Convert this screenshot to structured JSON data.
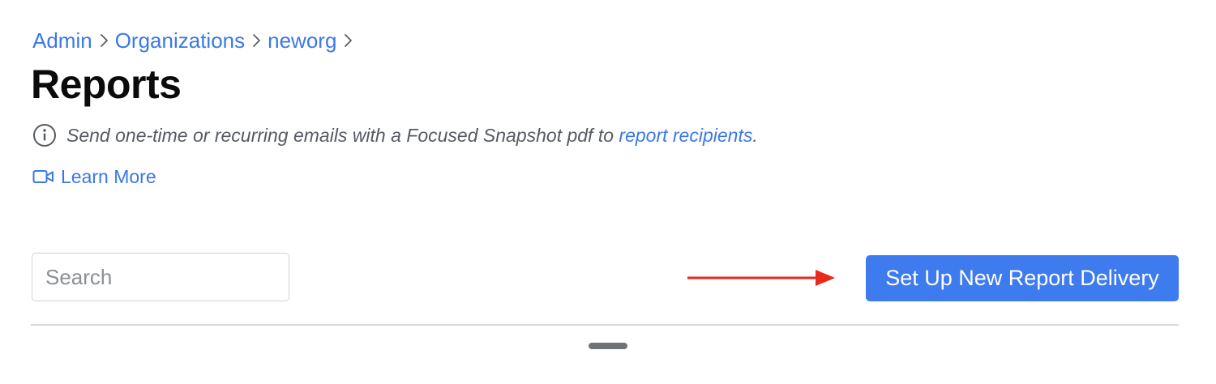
{
  "breadcrumb": {
    "items": [
      {
        "label": "Admin"
      },
      {
        "label": "Organizations"
      },
      {
        "label": "neworg"
      }
    ]
  },
  "page": {
    "title": "Reports"
  },
  "info": {
    "text": "Send one-time or recurring emails with a Focused Snapshot pdf to ",
    "link_text": "report recipients",
    "suffix": "."
  },
  "learn_more": {
    "label": "Learn More",
    "icon": "video-camera-icon"
  },
  "search": {
    "placeholder": "Search",
    "value": ""
  },
  "actions": {
    "setup_button_label": "Set Up New Report Delivery"
  },
  "colors": {
    "accent": "#3b78e7",
    "button": "#3d7bef",
    "annotation_arrow": "#e8291c",
    "divider": "#d7d9dc"
  }
}
